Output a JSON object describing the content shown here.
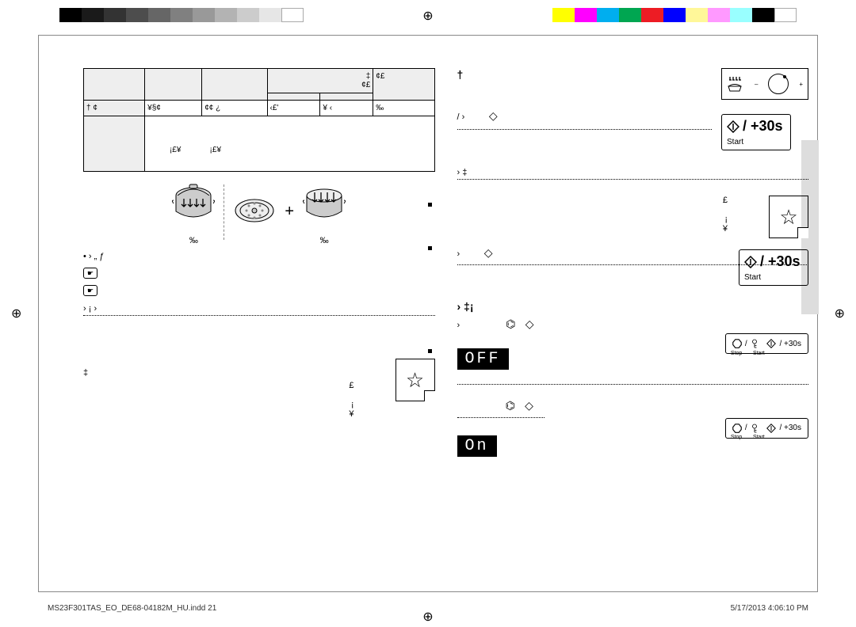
{
  "print": {
    "filename": "MS23F301TAS_EO_DE68-04182M_HU.indd   21",
    "timestamp": "5/17/2013   4:06:10 PM"
  },
  "table": {
    "r1": {
      "c3a": "‡",
      "c3b": "¢£",
      "c4": "¢£"
    },
    "r2": {
      "c1": "† ¢",
      "c2": "¥§¢",
      "c3": "¢¢ ¿",
      "c4": "‹£'",
      "c5": "¥ ‹",
      "c6": "‰"
    },
    "r3": {
      "span_a": "¡£¥",
      "span_b": "¡£¥"
    }
  },
  "potlabels": {
    "left": "‰",
    "right": "‰"
  },
  "tips": {
    "heading": "• › „  ƒ",
    "line1": " ",
    "line2": " ",
    "rule_text": "›          ¡ ›"
  },
  "left_sec": {
    "title": " ",
    "p1": "‡",
    "p2": "£",
    "p3": "¡",
    "p4": "¥"
  },
  "right": {
    "headline": "†",
    "p1": " ",
    "step1_num": "/ ›",
    "step1_txt": " ",
    "step2_txt": "›                        ‡",
    "step3a": "£",
    "step3b": "¡",
    "step3c": "¥",
    "step3_num2": "›",
    "sec2_title": "›         ‡¡",
    "sec2_body": "›",
    "off": "OFF",
    "on": "On"
  },
  "buttons": {
    "start_plus30": "/ +30s",
    "start": "Start",
    "stop": "Stop"
  },
  "glyphs": {
    "diamond_i": "◇",
    "diamond_start": "◇",
    "hex_stop": "⎔",
    "key": "⚿"
  }
}
